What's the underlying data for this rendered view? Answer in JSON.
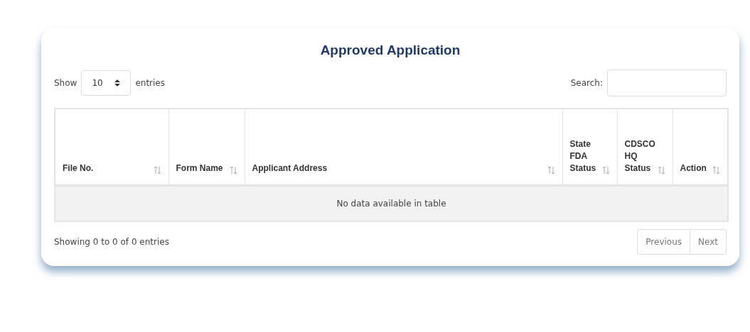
{
  "title": "Approved Application",
  "length_menu": {
    "before": "Show",
    "value": "10",
    "after": "entries"
  },
  "search": {
    "label": "Search:"
  },
  "table": {
    "columns": [
      {
        "label": "File No.",
        "sortable": true
      },
      {
        "label": "Form Name",
        "sortable": true
      },
      {
        "label": "Applicant Address",
        "sortable": true
      },
      {
        "label": "State FDA Status",
        "sortable": true
      },
      {
        "label": "CDSCO HQ Status",
        "sortable": true
      },
      {
        "label": "Action",
        "sortable": true
      }
    ],
    "empty_message": "No data available in table"
  },
  "info": "Showing 0 to 0 of 0 entries",
  "pagination": [
    {
      "label": "Previous",
      "disabled": true
    },
    {
      "label": "Next",
      "disabled": true
    }
  ]
}
